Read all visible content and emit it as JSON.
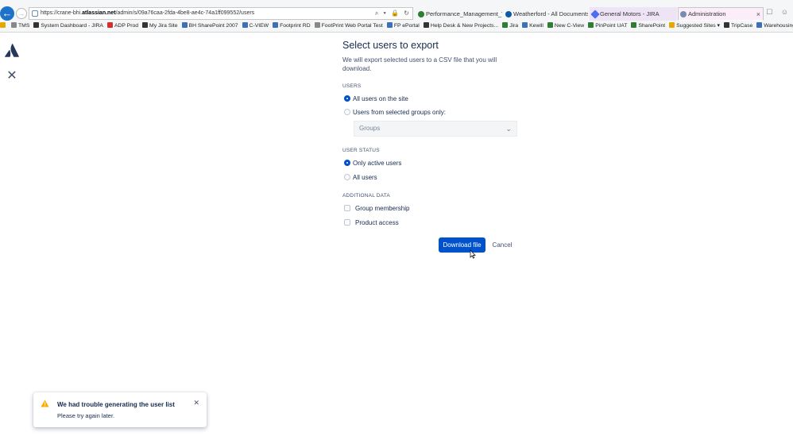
{
  "browser": {
    "url_prefix": "https://crane-bhi.",
    "url_domain": "atlassian.net",
    "url_path": "/admin/s/09a76caa-2fda-4be8-ae4c-74a1ff099552/users",
    "addr_tools": "⌕ ▾ 🔒 ↻",
    "tabs": [
      {
        "label": "Performance_Management_Tool",
        "color": "#2e7d32"
      },
      {
        "label": "Weatherford - All Documents",
        "color": "#0b5aa8"
      },
      {
        "label": "General Motors - JIRA",
        "color": "#4c6ef5"
      },
      {
        "label": "Administration",
        "color": "#7a8bb0"
      }
    ],
    "tab_close": "×",
    "window_icons": "☐ ☺"
  },
  "favorites": [
    {
      "label": "",
      "color": "#e6a800"
    },
    {
      "label": "TMS",
      "color": "#888888"
    },
    {
      "label": "System Dashboard - JIRA",
      "color": "#333333"
    },
    {
      "label": "ADP Prod",
      "color": "#d32f2f"
    },
    {
      "label": "My Jira Site",
      "color": "#333333"
    },
    {
      "label": "BH SharePoint 2007",
      "color": "#3f6fb5"
    },
    {
      "label": "C-VIEW",
      "color": "#3f6fb5"
    },
    {
      "label": "Footprint RD",
      "color": "#3f6fb5"
    },
    {
      "label": "FootPrint Web Portal Test",
      "color": "#888888"
    },
    {
      "label": "FP ePortal",
      "color": "#3f6fb5"
    },
    {
      "label": "Help Desk & New Projects...",
      "color": "#333333"
    },
    {
      "label": "Jira",
      "color": "#2e7d32"
    },
    {
      "label": "Kewill",
      "color": "#3f6fb5"
    },
    {
      "label": "New C-View",
      "color": "#2e7d32"
    },
    {
      "label": "PinPoint UAT",
      "color": "#2e7d32"
    },
    {
      "label": "SharePoint",
      "color": "#2e7d32"
    },
    {
      "label": "Suggested Sites ▾",
      "color": "#e6a800"
    },
    {
      "label": "TripCase",
      "color": "#333333"
    },
    {
      "label": "Warehousing & Distr...",
      "color": "#3f6fb5"
    }
  ],
  "nav": {
    "close_glyph": "✕"
  },
  "form": {
    "title": "Select users to export",
    "description": "We will export selected users to a CSV file that you will download.",
    "users_label": "USERS",
    "users_options": [
      "All users on the site",
      "Users from selected groups only:"
    ],
    "groups_placeholder": "Groups",
    "groups_chevron": "⌄",
    "status_label": "USER STATUS",
    "status_options": [
      "Only active users",
      "All users"
    ],
    "additional_label": "ADDITIONAL DATA",
    "additional_options": [
      "Group membership",
      "Product access"
    ],
    "download_label": "Download file",
    "cancel_label": "Cancel"
  },
  "flag": {
    "title": "We had trouble generating the user list",
    "body": "Please try again later.",
    "close_glyph": "✕",
    "warn_color": "#ffab00"
  },
  "colors": {
    "primary": "#0052cc",
    "text": "#172b4d",
    "subtle": "#42526e"
  }
}
